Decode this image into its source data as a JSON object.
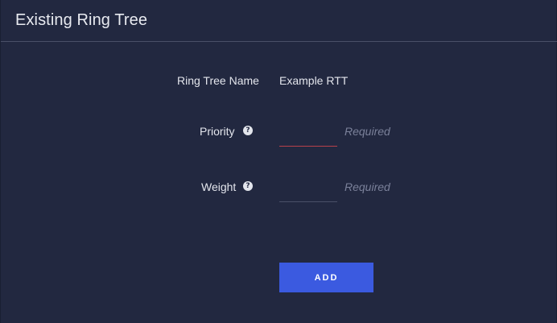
{
  "header": {
    "title": "Existing Ring Tree"
  },
  "form": {
    "ring_tree_name": {
      "label": "Ring Tree Name",
      "value": "Example RTT"
    },
    "priority": {
      "label": "Priority",
      "help_icon": "question-circle-icon",
      "value": "",
      "hint": "Required",
      "state": "error"
    },
    "weight": {
      "label": "Weight",
      "help_icon": "question-circle-icon",
      "value": "",
      "hint": "Required",
      "state": "normal"
    },
    "add_label": "ADD"
  },
  "colors": {
    "background": "#222840",
    "accent": "#3b5ae0",
    "error": "#b8414b",
    "hint": "#7a8099"
  }
}
